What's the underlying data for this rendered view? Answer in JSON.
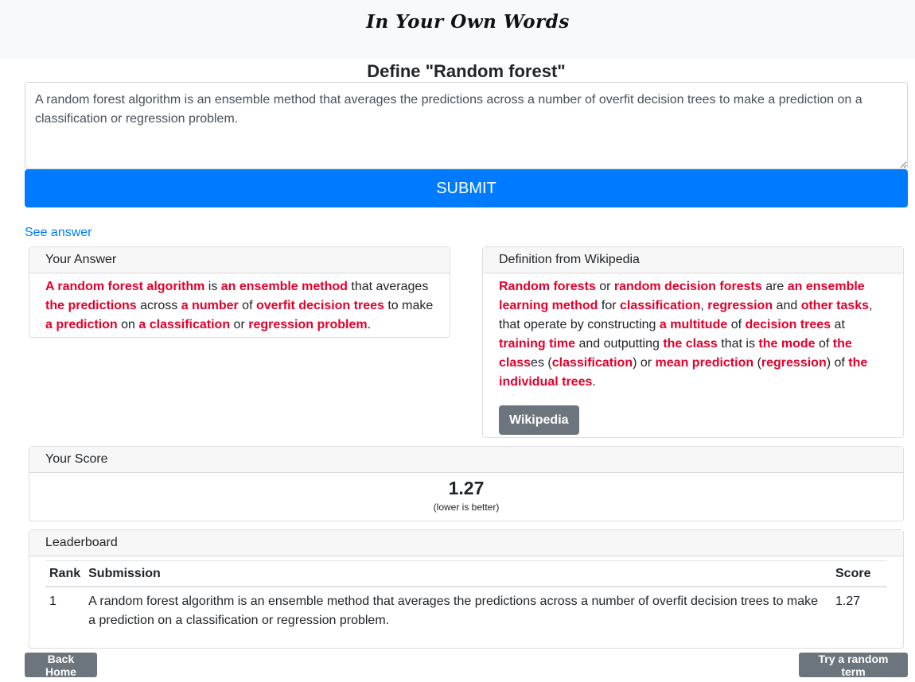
{
  "navbar": {
    "brand": "In Your Own Words"
  },
  "page": {
    "title": "Define \"Random forest\""
  },
  "form": {
    "answer_value": "A random forest algorithm is an ensemble method that averages the predictions across a number of overfit decision trees to make a prediction on a classification or regression problem.",
    "submit_label": "SUBMIT",
    "see_answer_label": "See answer"
  },
  "your_answer": {
    "header": "Your Answer",
    "segments": [
      {
        "text": "A random forest algorithm",
        "highlight": true
      },
      {
        "text": " is ",
        "highlight": false
      },
      {
        "text": "an ensemble method",
        "highlight": true
      },
      {
        "text": " that averages ",
        "highlight": false
      },
      {
        "text": "the predictions",
        "highlight": true
      },
      {
        "text": " across ",
        "highlight": false
      },
      {
        "text": "a number",
        "highlight": true
      },
      {
        "text": " of ",
        "highlight": false
      },
      {
        "text": "overfit decision trees",
        "highlight": true
      },
      {
        "text": " to make ",
        "highlight": false
      },
      {
        "text": "a prediction",
        "highlight": true
      },
      {
        "text": " on ",
        "highlight": false
      },
      {
        "text": "a classification",
        "highlight": true
      },
      {
        "text": " or ",
        "highlight": false
      },
      {
        "text": "regression problem",
        "highlight": true
      },
      {
        "text": ".",
        "highlight": false
      }
    ]
  },
  "wikipedia": {
    "header": "Definition from Wikipedia",
    "segments": [
      {
        "text": "Random forests",
        "highlight": true
      },
      {
        "text": " or ",
        "highlight": false
      },
      {
        "text": "random decision forests",
        "highlight": true
      },
      {
        "text": " are ",
        "highlight": false
      },
      {
        "text": "an ensemble learning method",
        "highlight": true
      },
      {
        "text": " for ",
        "highlight": false
      },
      {
        "text": "classification",
        "highlight": true
      },
      {
        "text": ", ",
        "highlight": false
      },
      {
        "text": "regression",
        "highlight": true
      },
      {
        "text": " and ",
        "highlight": false
      },
      {
        "text": "other tasks",
        "highlight": true
      },
      {
        "text": ", that operate by constructing ",
        "highlight": false
      },
      {
        "text": "a multitude",
        "highlight": true
      },
      {
        "text": " of ",
        "highlight": false
      },
      {
        "text": "decision trees",
        "highlight": true
      },
      {
        "text": " at ",
        "highlight": false
      },
      {
        "text": "training time",
        "highlight": true
      },
      {
        "text": " and outputting ",
        "highlight": false
      },
      {
        "text": "the class",
        "highlight": true
      },
      {
        "text": " that is ",
        "highlight": false
      },
      {
        "text": "the mode",
        "highlight": true
      },
      {
        "text": " of ",
        "highlight": false
      },
      {
        "text": "the class",
        "highlight": true
      },
      {
        "text": "es (",
        "highlight": false
      },
      {
        "text": "classification",
        "highlight": true
      },
      {
        "text": ") or ",
        "highlight": false
      },
      {
        "text": "mean prediction",
        "highlight": true
      },
      {
        "text": " (",
        "highlight": false
      },
      {
        "text": "regression",
        "highlight": true
      },
      {
        "text": ") of ",
        "highlight": false
      },
      {
        "text": "the individual trees",
        "highlight": true
      },
      {
        "text": ".",
        "highlight": false
      }
    ],
    "button_label": "Wikipedia"
  },
  "score": {
    "header": "Your Score",
    "value": "1.27",
    "note": "(lower is better)"
  },
  "leaderboard": {
    "header": "Leaderboard",
    "columns": [
      "Rank",
      "Submission",
      "Score"
    ],
    "rows": [
      {
        "rank": "1",
        "submission": "A random forest algorithm is an ensemble method that averages the predictions across a number of overfit decision trees to make a prediction on a classification or regression problem.",
        "score": "1.27"
      }
    ]
  },
  "footer": {
    "back_home_label": "Back Home",
    "random_term_label": "Try a random term"
  },
  "colors": {
    "primary": "#007bff",
    "highlight": "#e4002b",
    "secondary_button": "#6c757d"
  }
}
